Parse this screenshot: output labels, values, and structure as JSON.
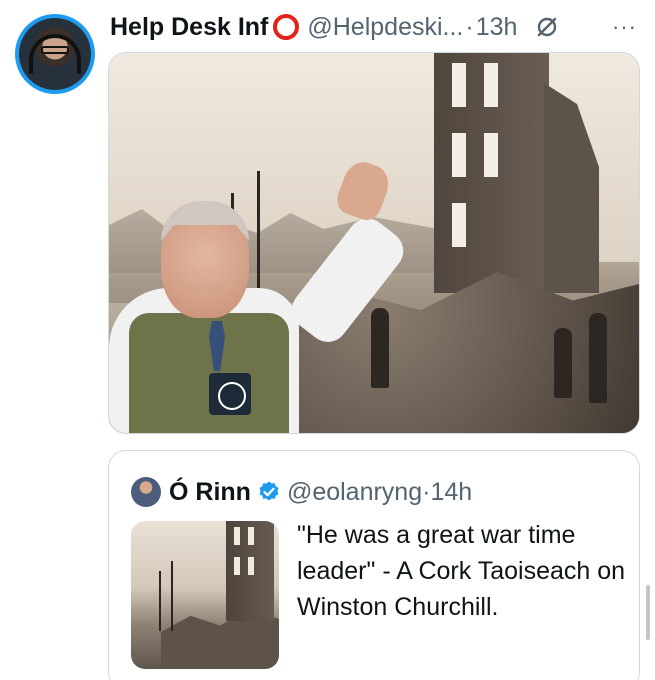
{
  "post": {
    "author_name": "Help Desk Inf",
    "handle": "@Helpdeski...",
    "separator": "·",
    "time": "13h",
    "more_label": "···"
  },
  "quoted_post": {
    "author_name": "Ó Rinn",
    "handle": "@eolanryng",
    "separator": "·",
    "time": "14h",
    "text": "\"He was a great war time leader\" - A Cork Taoiseach on Winston Churchill."
  },
  "colors": {
    "accent": "#1d9bf0",
    "ring": "#e5221a",
    "secondary_text": "#536471"
  }
}
